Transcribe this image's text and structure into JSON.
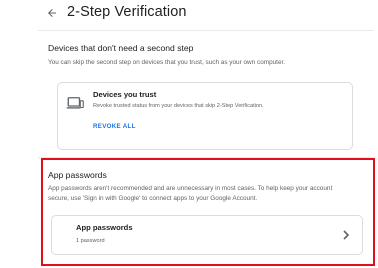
{
  "header": {
    "back_icon": "arrow-back-icon",
    "title": "2-Step Verification"
  },
  "devices_section": {
    "title": "Devices that don't need a second step",
    "description": "You can skip the second step on devices that you trust, such as your own computer.",
    "card": {
      "icon": "laptop-icon",
      "title": "Devices you trust",
      "description": "Revoke trusted status from your devices that skip 2-Step Verification.",
      "action_label": "REVOKE ALL"
    }
  },
  "app_passwords_section": {
    "title": "App passwords",
    "description_line1": "App passwords aren't recommended and are unnecessary in most cases. To help keep your account",
    "description_line2": "secure, use 'Sign in with Google' to connect apps to your Google Account.",
    "card": {
      "title": "App passwords",
      "subtitle": "1 password",
      "chevron_icon": "chevron-right-icon"
    }
  },
  "colors": {
    "accent": "#1a73e8",
    "highlight": "#e10f1c",
    "text_primary": "#202124",
    "text_secondary": "#5f6368",
    "border": "#dadce0"
  }
}
